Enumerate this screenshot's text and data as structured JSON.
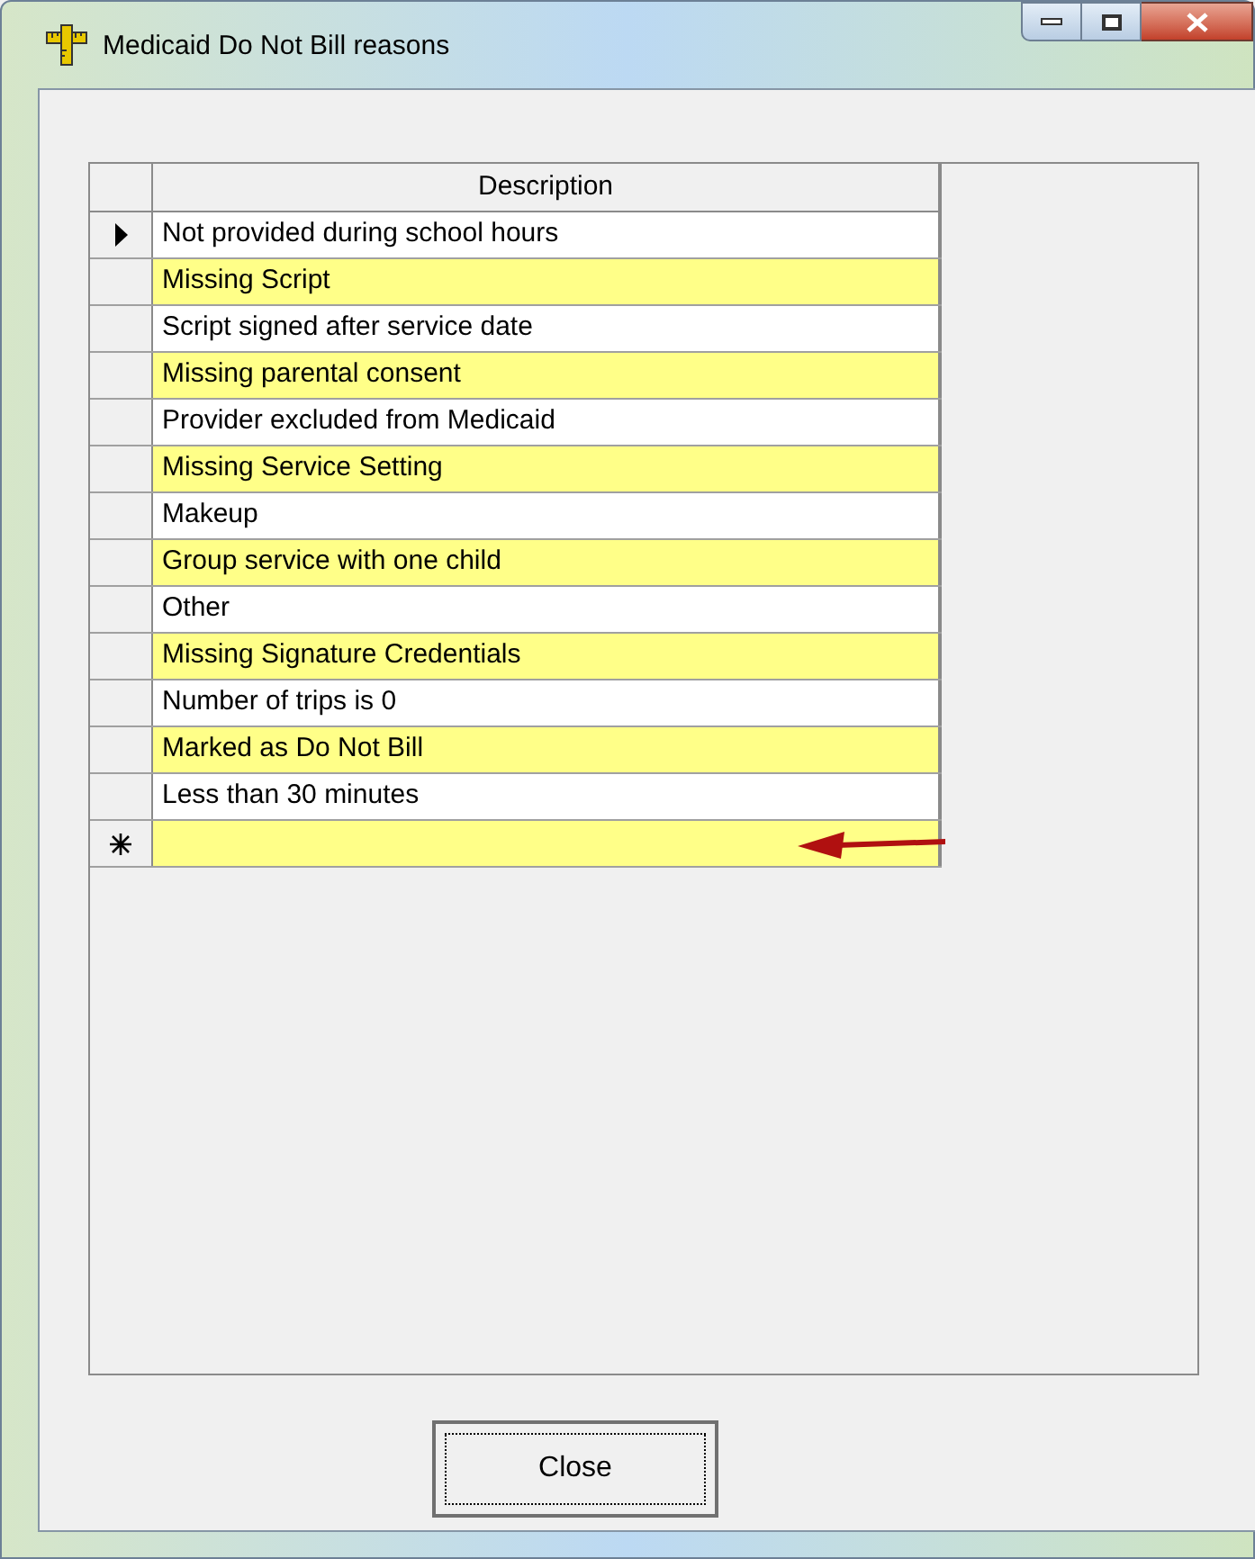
{
  "window": {
    "title": "Medicaid Do Not Bill reasons"
  },
  "grid": {
    "columns": [
      "Description"
    ],
    "rows": [
      {
        "description": "Not provided during school hours",
        "selected": true
      },
      {
        "description": "Missing Script",
        "selected": false
      },
      {
        "description": "Script signed after service date",
        "selected": false
      },
      {
        "description": "Missing parental consent",
        "selected": false
      },
      {
        "description": "Provider excluded from Medicaid",
        "selected": false
      },
      {
        "description": "Missing Service Setting",
        "selected": false
      },
      {
        "description": "Makeup",
        "selected": false
      },
      {
        "description": "Group service with one child",
        "selected": false
      },
      {
        "description": "Other",
        "selected": false
      },
      {
        "description": "Missing Signature Credentials",
        "selected": false
      },
      {
        "description": "Number of trips is 0",
        "selected": false
      },
      {
        "description": "Marked as Do Not Bill",
        "selected": false
      },
      {
        "description": "Less than 30 minutes",
        "selected": false
      }
    ],
    "new_row": {
      "pointed_at": true
    }
  },
  "buttons": [
    "Close"
  ]
}
